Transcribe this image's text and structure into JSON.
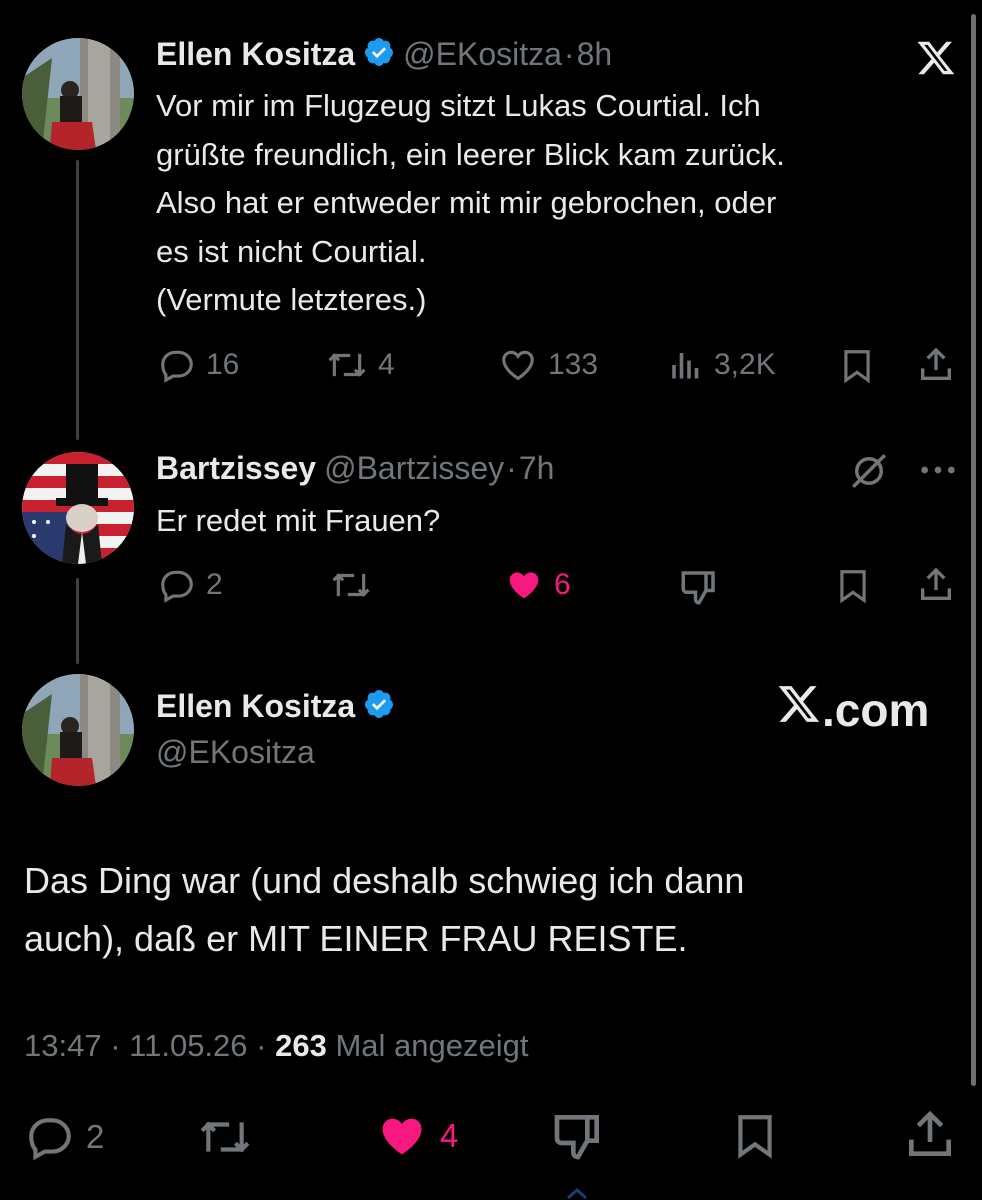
{
  "tweet1": {
    "name": "Ellen Kositza",
    "handle": "@EKositza",
    "separator": "·",
    "time": "8h",
    "text": "Vor mir im Flugzeug sitzt Lukas Courtial. Ich\ngrüßte freundlich, ein leerer Blick kam zurück.\nAlso hat er entweder mit mir gebrochen, oder\nes ist nicht Courtial.\n(Vermute letzteres.)",
    "replies": "16",
    "reposts": "4",
    "likes": "133",
    "views": "3,2K"
  },
  "tweet2": {
    "name": "Bartzissey",
    "handle": "@Bartzissey",
    "separator": "·",
    "time": "7h",
    "text": "Er redet mit Frauen?",
    "replies": "2",
    "likes": "6"
  },
  "tweet3": {
    "name": "Ellen Kositza",
    "handle": "@EKositza",
    "text": "Das Ding war (und deshalb schwieg ich dann\nauch), daß er MIT EINER FRAU REISTE.",
    "time": "13:47",
    "sep1": "·",
    "date": "11.05.26",
    "sep2": "·",
    "views_count": "263",
    "views_label": "Mal angezeigt",
    "replies": "2",
    "likes": "4"
  },
  "branding": {
    "xcom_rest": ".com"
  },
  "colors": {
    "background": "#000000",
    "text": "#e7e9ea",
    "muted": "#71767b",
    "like": "#f91880",
    "verified": "#1d9bf0"
  },
  "icons": [
    "x-logo-icon",
    "verified-badge-icon",
    "reply-icon",
    "repost-icon",
    "like-icon",
    "views-icon",
    "bookmark-icon",
    "share-icon",
    "grok-icon",
    "more-icon",
    "dislike-icon"
  ]
}
